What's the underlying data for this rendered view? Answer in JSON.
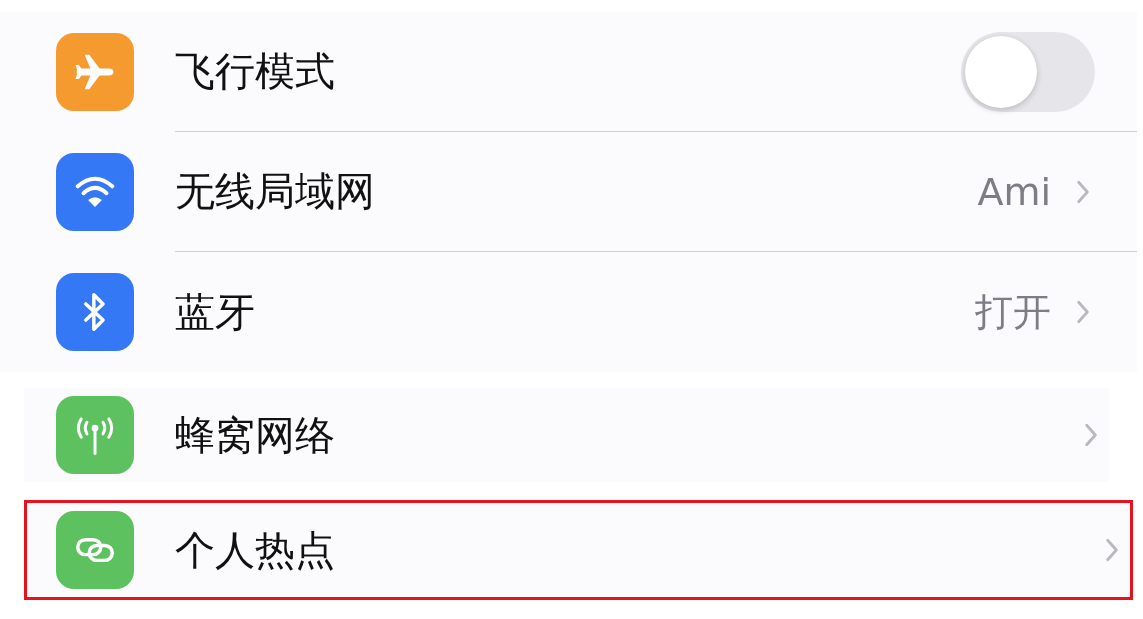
{
  "settings_rows": [
    {
      "kind": "toggle",
      "color": "#f59a2f",
      "label": "飞行模式",
      "on": false,
      "highlighted": false
    },
    {
      "kind": "link",
      "color": "#3478f6",
      "label": "无线局域网",
      "value": "Ami",
      "highlighted": false
    },
    {
      "kind": "link",
      "color": "#3478f6",
      "label": "蓝牙",
      "value": "打开",
      "highlighted": false
    },
    {
      "kind": "link",
      "color": "#5ec15f",
      "label": "蜂窝网络",
      "highlighted": false
    },
    {
      "kind": "link",
      "color": "#5ec15f",
      "label": "个人热点",
      "highlighted": true
    }
  ]
}
